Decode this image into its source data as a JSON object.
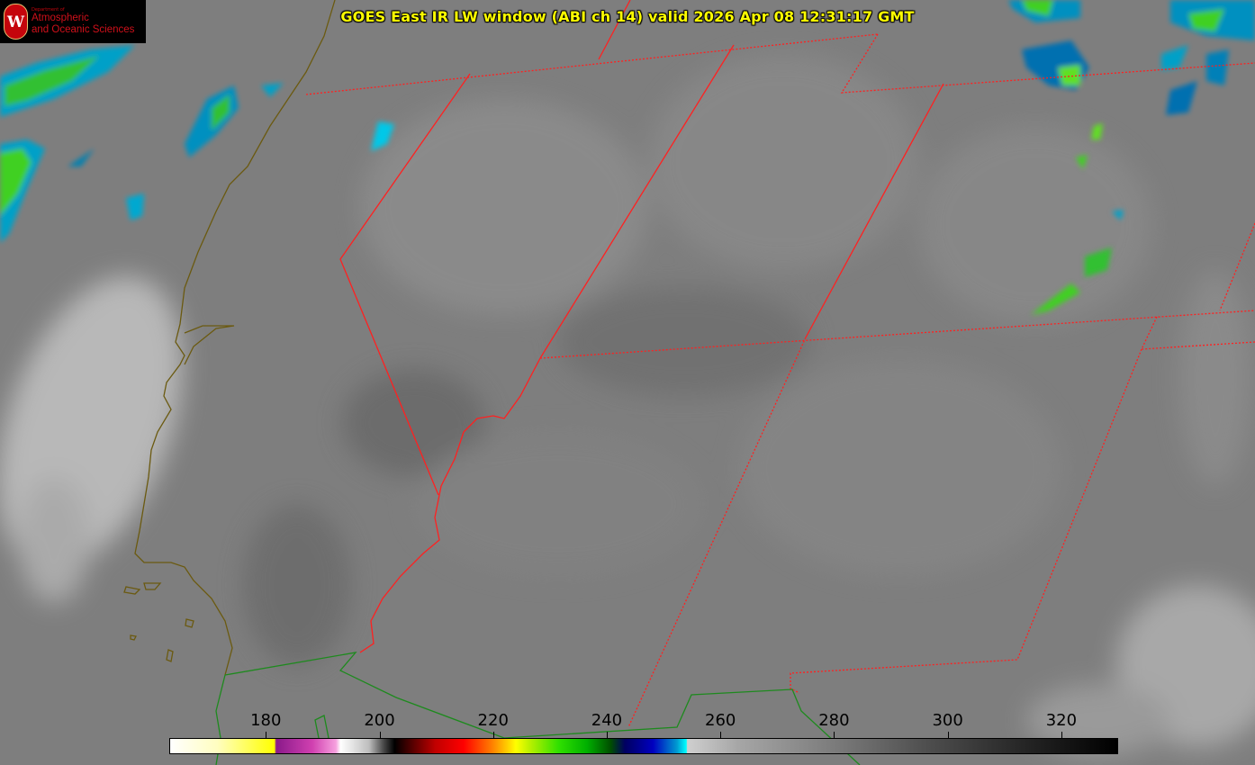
{
  "title": "GOES East IR LW window (ABI ch 14) valid 2026 Apr 08 12:31:17 GMT",
  "logo": {
    "line_small": "Department of",
    "line1": "Atmospheric",
    "line2": "and Oceanic Sciences",
    "seal_letter": "W"
  },
  "colorbar": {
    "min": 163,
    "max": 330,
    "ticks": [
      "180",
      "200",
      "220",
      "240",
      "260",
      "280",
      "300",
      "320"
    ]
  },
  "colors": {
    "title": "#ffff00",
    "state_borders": "#ff2020",
    "coastline": "#6b5a10",
    "country_border": "#1e8a1e"
  }
}
